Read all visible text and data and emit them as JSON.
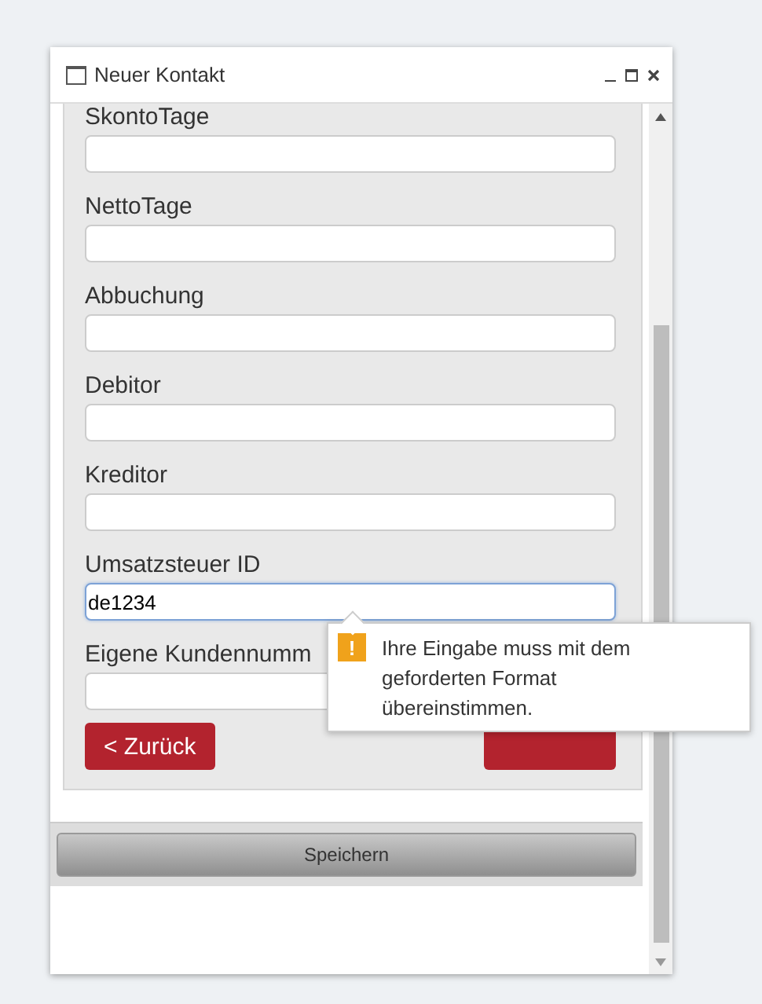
{
  "window": {
    "title": "Neuer Kontakt"
  },
  "fields": [
    {
      "label": "SkontoTage",
      "focused": false
    },
    {
      "label": "NettoTage",
      "focused": false
    },
    {
      "label": "Abbuchung",
      "focused": false
    },
    {
      "label": "Debitor",
      "focused": false
    },
    {
      "label": "Kreditor",
      "focused": false
    },
    {
      "label": "Umsatzsteuer ID",
      "value": "de1234",
      "focused": true
    },
    {
      "label": "Eigene Kundennumm",
      "focused": false
    }
  ],
  "back_button": "< Zurück",
  "tooltip": {
    "text": "Ihre Eingabe muss mit dem geforderten Format übereinstimmen.",
    "icon": "!"
  },
  "save_button": "Speichern"
}
